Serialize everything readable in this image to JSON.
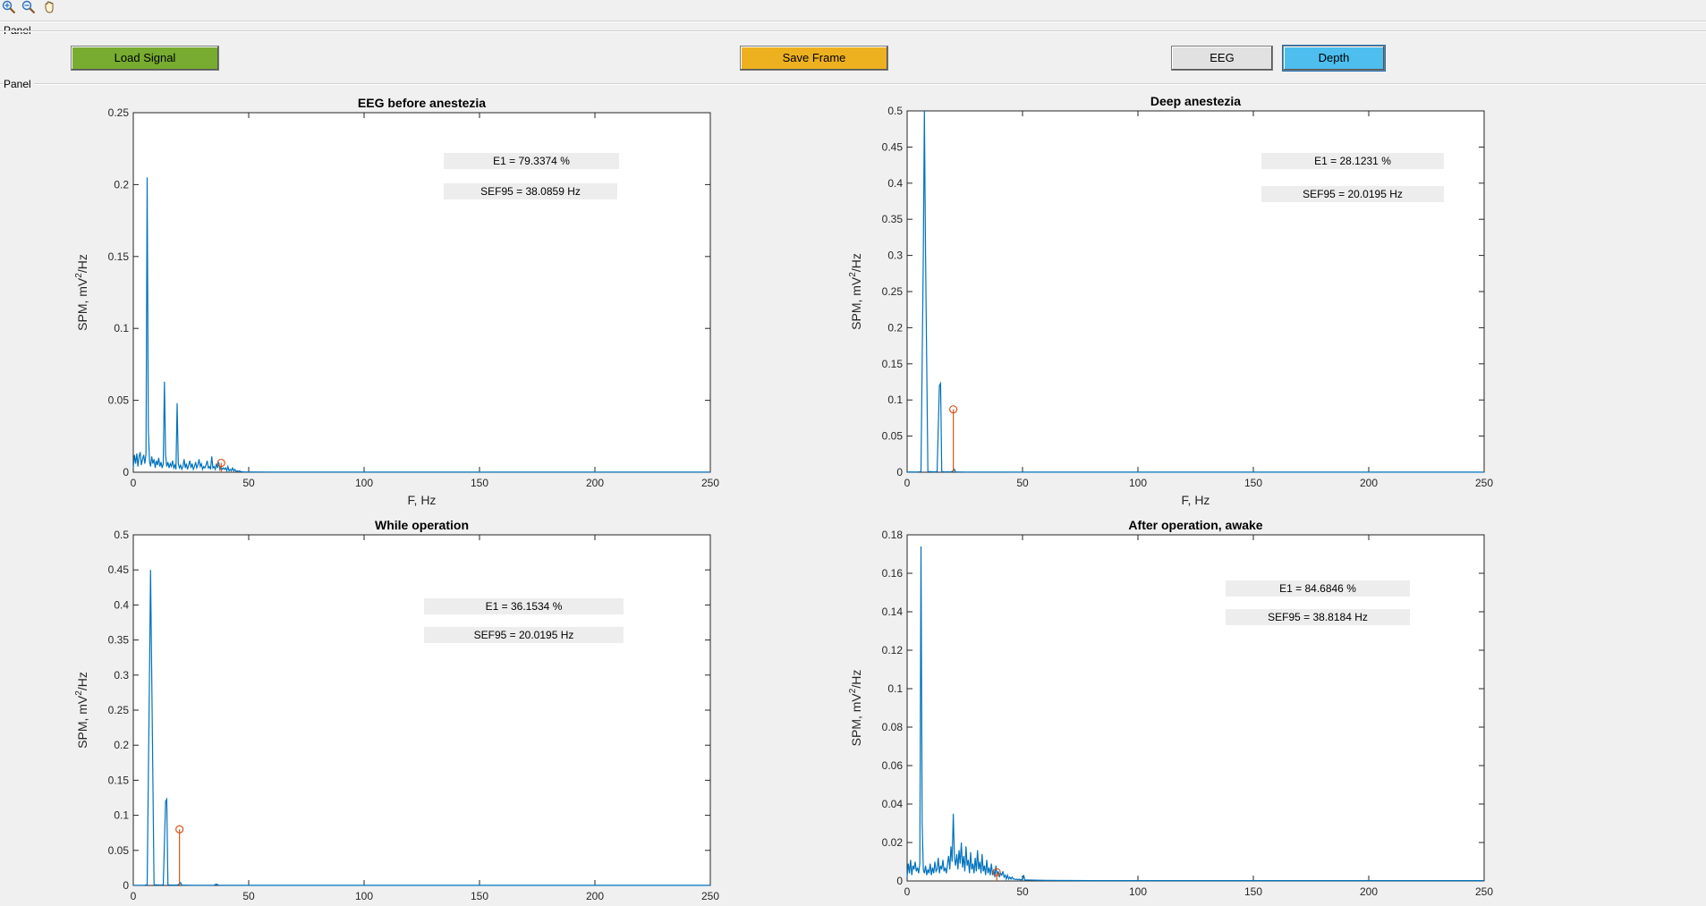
{
  "colors": {
    "background": "#f0f0f0",
    "signal": "#0072bd",
    "marker": "#d95319",
    "load_button": "#77ac30",
    "save_button": "#edb120",
    "eeg_button": "#e1e1e1",
    "depth_button": "#4dbeee",
    "annotation_bg": "#ededed"
  },
  "toolbar": {
    "icons": [
      "zoom-in-icon",
      "zoom-out-icon",
      "pan-hand-icon"
    ]
  },
  "panels": {
    "top_label": "Panel",
    "plots_label": "Panel"
  },
  "buttons": {
    "load_signal": "Load Signal",
    "save_frame": "Save Frame",
    "eeg": "EEG",
    "depth": "Depth"
  },
  "chart_data": [
    {
      "type": "line",
      "title": "EEG before anestezia",
      "xlabel": "F, Hz",
      "ylabel": "SPM, mV^2/Hz",
      "xlim": [
        0,
        250
      ],
      "ylim": [
        0,
        0.25
      ],
      "xticks": [
        0,
        50,
        100,
        150,
        200,
        250
      ],
      "yticks": [
        0,
        0.05,
        0.1,
        0.15,
        0.2,
        0.25
      ],
      "ytick_labels": [
        "0",
        "0.05",
        "0.1",
        "0.15",
        "0.2",
        "0.25"
      ],
      "series": [
        {
          "style": "line",
          "color": "#0072bd",
          "x": [
            0,
            0.5,
            1,
            1.5,
            2,
            2.5,
            3,
            3.5,
            4,
            4.5,
            5,
            5.5,
            6,
            6.5,
            7,
            7.5,
            8,
            8.5,
            9,
            9.5,
            10,
            10.5,
            11,
            11.5,
            12,
            12.5,
            13,
            13.5,
            14,
            14.5,
            15,
            15.5,
            16,
            16.5,
            17,
            17.5,
            18,
            18.5,
            19,
            19.5,
            20,
            20.5,
            21,
            21.5,
            22,
            22.5,
            23,
            23.5,
            24,
            24.5,
            25,
            25.5,
            26,
            26.5,
            27,
            27.5,
            28,
            28.5,
            29,
            29.5,
            30,
            30.5,
            31,
            31.5,
            32,
            32.5,
            33,
            33.5,
            34,
            34.5,
            35,
            35.5,
            36,
            36.5,
            37,
            37.5,
            38,
            38.5,
            39,
            39.5,
            40,
            40.5,
            41,
            41.5,
            42,
            42.5,
            43,
            43.5,
            44,
            44.5,
            45,
            45.5,
            46,
            46.5,
            47,
            47.5,
            48,
            48.5,
            49,
            50,
            60,
            80,
            100,
            150,
            200,
            250
          ],
          "y": [
            0.003,
            0.012,
            0.006,
            0.013,
            0.004,
            0.011,
            0.014,
            0.005,
            0.009,
            0.012,
            0.006,
            0.013,
            0.205,
            0.03,
            0.008,
            0.004,
            0.011,
            0.006,
            0.009,
            0.003,
            0.008,
            0.005,
            0.01,
            0.004,
            0.007,
            0.003,
            0.006,
            0.063,
            0.012,
            0.004,
            0.007,
            0.003,
            0.006,
            0.004,
            0.008,
            0.003,
            0.005,
            0.002,
            0.048,
            0.006,
            0.003,
            0.005,
            0.002,
            0.004,
            0.009,
            0.003,
            0.006,
            0.002,
            0.005,
            0.008,
            0.003,
            0.006,
            0.002,
            0.004,
            0.007,
            0.003,
            0.005,
            0.009,
            0.004,
            0.006,
            0.002,
            0.004,
            0.003,
            0.005,
            0.008,
            0.003,
            0.004,
            0.002,
            0.011,
            0.003,
            0.004,
            0.002,
            0.006,
            0.003,
            0.007,
            0.002,
            0.004,
            0.002,
            0.003,
            0.002,
            0.003,
            0.001,
            0.004,
            0.001,
            0.002,
            0.001,
            0.003,
            0.001,
            0.002,
            0.0005,
            0.001,
            0.0005,
            0.001,
            0.0005,
            0.0003,
            0.0003,
            0.0002,
            0.0002,
            0.0002,
            0.0002,
            0.0001,
            0.0001,
            0.0001,
            0.0001,
            0.0001,
            0.0001
          ]
        },
        {
          "style": "stem",
          "color": "#d95319",
          "x": [
            38.09
          ],
          "y": [
            0.0065
          ]
        }
      ],
      "annotations": [
        "E1 = 79.3374 %",
        "SEF95 = 38.0859 Hz"
      ]
    },
    {
      "type": "line",
      "title": "Deep anestezia",
      "xlabel": "F, Hz",
      "ylabel": "SPM, mV^2/Hz",
      "xlim": [
        0,
        250
      ],
      "ylim": [
        0,
        0.5
      ],
      "xticks": [
        0,
        50,
        100,
        150,
        200,
        250
      ],
      "yticks": [
        0,
        0.05,
        0.1,
        0.15,
        0.2,
        0.25,
        0.3,
        0.35,
        0.4,
        0.45,
        0.5
      ],
      "ytick_labels": [
        "0",
        "0.05",
        "0.1",
        "0.15",
        "0.2",
        "0.25",
        "0.3",
        "0.35",
        "0.4",
        "0.45",
        "0.5"
      ],
      "series": [
        {
          "style": "line",
          "color": "#0072bd",
          "x": [
            0,
            5,
            6,
            7,
            7.5,
            8,
            9,
            12,
            13,
            14,
            14.5,
            15,
            16,
            19,
            20,
            20.5,
            21,
            25,
            30,
            40,
            50,
            60,
            80,
            100,
            150,
            200,
            250
          ],
          "y": [
            0.0003,
            0.0004,
            0.001,
            0.3,
            0.5,
            0.3,
            0.001,
            0.0005,
            0.001,
            0.12,
            0.123,
            0.001,
            0.0005,
            0.0005,
            0.002,
            0.004,
            0.0005,
            0.0003,
            0.0002,
            0.0002,
            0.0001,
            0.0001,
            0.0001,
            0.0001,
            0.0001,
            0.0001,
            0.0001
          ]
        },
        {
          "style": "stem",
          "color": "#d95319",
          "x": [
            20.02
          ],
          "y": [
            0.087
          ]
        }
      ],
      "annotations": [
        "E1 = 28.1231 %",
        "SEF95 = 20.0195 Hz"
      ]
    },
    {
      "type": "line",
      "title": "While operation",
      "xlabel": "",
      "ylabel": "SPM, mV^2/Hz",
      "xlim": [
        0,
        250
      ],
      "ylim": [
        0,
        0.5
      ],
      "xticks": [
        0,
        50,
        100,
        150,
        200,
        250
      ],
      "yticks": [
        0,
        0.05,
        0.1,
        0.15,
        0.2,
        0.25,
        0.3,
        0.35,
        0.4,
        0.45,
        0.5
      ],
      "ytick_labels": [
        "0",
        "0.05",
        "0.1",
        "0.15",
        "0.2",
        "0.25",
        "0.3",
        "0.35",
        "0.4",
        "0.45",
        "0.5"
      ],
      "series": [
        {
          "style": "line",
          "color": "#0072bd",
          "x": [
            0,
            5,
            6,
            7,
            7.5,
            8,
            9,
            12,
            13,
            14,
            14.5,
            15,
            16,
            19,
            20,
            20.5,
            21,
            25,
            30,
            35,
            36,
            37,
            40,
            50,
            60,
            80,
            100,
            150,
            200,
            250
          ],
          "y": [
            0.0003,
            0.0004,
            0.001,
            0.3,
            0.45,
            0.3,
            0.001,
            0.0005,
            0.001,
            0.12,
            0.123,
            0.001,
            0.0005,
            0.0005,
            0.002,
            0.004,
            0.0005,
            0.0003,
            0.0002,
            0.0002,
            0.002,
            0.0002,
            0.0002,
            0.0001,
            0.0001,
            0.0001,
            0.0001,
            0.0001,
            0.0001,
            0.0001
          ]
        },
        {
          "style": "stem",
          "color": "#d95319",
          "x": [
            20.02
          ],
          "y": [
            0.08
          ]
        }
      ],
      "annotations": [
        "E1 = 36.1534 %",
        "SEF95 = 20.0195 Hz"
      ]
    },
    {
      "type": "line",
      "title": "After operation, awake",
      "xlabel": "",
      "ylabel": "SPM, mV^2/Hz",
      "xlim": [
        0,
        250
      ],
      "ylim": [
        0,
        0.18
      ],
      "xticks": [
        0,
        50,
        100,
        150,
        200,
        250
      ],
      "yticks": [
        0,
        0.02,
        0.04,
        0.06,
        0.08,
        0.1,
        0.12,
        0.14,
        0.16,
        0.18
      ],
      "ytick_labels": [
        "0",
        "0.02",
        "0.04",
        "0.06",
        "0.08",
        "0.1",
        "0.12",
        "0.14",
        "0.16",
        "0.18"
      ],
      "series": [
        {
          "style": "line",
          "color": "#0072bd",
          "x": [
            0,
            0.5,
            1,
            1.5,
            2,
            2.5,
            3,
            3.5,
            4,
            4.5,
            5,
            5.5,
            6,
            6.5,
            7,
            7.5,
            8,
            8.5,
            9,
            9.5,
            10,
            10.5,
            11,
            11.5,
            12,
            12.5,
            13,
            13.5,
            14,
            14.5,
            15,
            15.5,
            16,
            16.5,
            17,
            17.5,
            18,
            18.5,
            19,
            19.5,
            20,
            20.5,
            21,
            21.5,
            22,
            22.5,
            23,
            23.5,
            24,
            24.5,
            25,
            25.5,
            26,
            26.5,
            27,
            27.5,
            28,
            28.5,
            29,
            29.5,
            30,
            30.5,
            31,
            31.5,
            32,
            32.5,
            33,
            33.5,
            34,
            34.5,
            35,
            35.5,
            36,
            36.5,
            37,
            37.5,
            38,
            38.5,
            39,
            39.5,
            40,
            40.5,
            41,
            41.5,
            42,
            42.5,
            43,
            43.5,
            44,
            44.5,
            45,
            45.5,
            46,
            46.5,
            47,
            47.5,
            48,
            48.5,
            49,
            49.5,
            50,
            50.5,
            51,
            60,
            80,
            100,
            150,
            200,
            250
          ],
          "y": [
            0.002,
            0.009,
            0.004,
            0.011,
            0.003,
            0.008,
            0.006,
            0.01,
            0.005,
            0.007,
            0.004,
            0.009,
            0.174,
            0.03,
            0.006,
            0.004,
            0.008,
            0.003,
            0.006,
            0.004,
            0.009,
            0.003,
            0.007,
            0.004,
            0.01,
            0.005,
            0.006,
            0.012,
            0.004,
            0.008,
            0.006,
            0.011,
            0.005,
            0.007,
            0.004,
            0.009,
            0.013,
            0.006,
            0.018,
            0.01,
            0.035,
            0.012,
            0.008,
            0.014,
            0.006,
            0.016,
            0.009,
            0.02,
            0.007,
            0.013,
            0.005,
            0.018,
            0.008,
            0.011,
            0.004,
            0.015,
            0.006,
            0.009,
            0.004,
            0.012,
            0.005,
            0.016,
            0.006,
            0.01,
            0.004,
            0.014,
            0.005,
            0.008,
            0.003,
            0.011,
            0.004,
            0.007,
            0.003,
            0.009,
            0.003,
            0.006,
            0.002,
            0.008,
            0.003,
            0.005,
            0.002,
            0.004,
            0.003,
            0.005,
            0.002,
            0.003,
            0.001,
            0.003,
            0.001,
            0.002,
            0.001,
            0.002,
            0.001,
            0.001,
            0.0007,
            0.001,
            0.0006,
            0.001,
            0.0005,
            0.0008,
            0.0005,
            0.003,
            0.0005,
            0.0003,
            0.0002,
            0.0002,
            0.0002,
            0.0002,
            0.0002
          ]
        },
        {
          "style": "stem",
          "color": "#d95319",
          "x": [
            38.82
          ],
          "y": [
            0.0045
          ]
        }
      ],
      "annotations": [
        "E1 = 84.6846 %",
        "SEF95 = 38.8184 Hz"
      ]
    }
  ]
}
